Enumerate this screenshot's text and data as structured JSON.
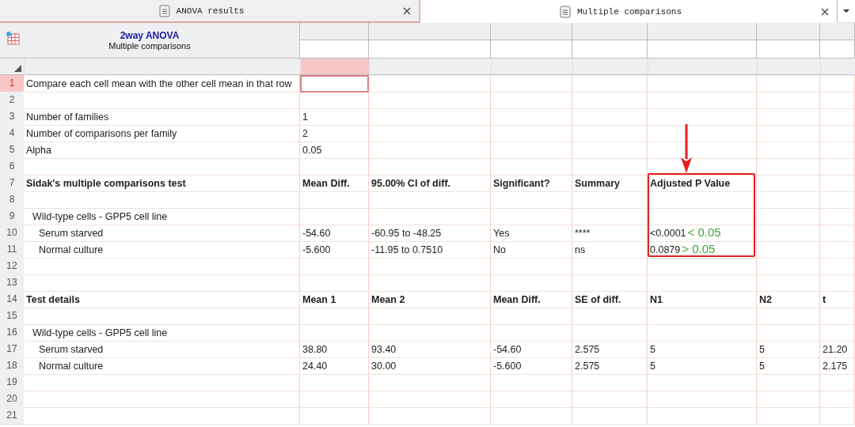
{
  "tabs": [
    {
      "label": "ANOVA results",
      "selected": false
    },
    {
      "label": "Multiple comparisons",
      "selected": true
    }
  ],
  "sheet_header": {
    "title": "2way ANOVA",
    "subtitle": "Multiple comparisons"
  },
  "column_headers": [
    {
      "selected": false
    },
    {
      "selected": true
    },
    {
      "selected": false
    },
    {
      "selected": false
    },
    {
      "selected": false
    },
    {
      "selected": false
    },
    {
      "selected": false
    },
    {
      "selected": false
    }
  ],
  "rows": [
    {
      "number": "1",
      "kind": "plain",
      "selected": true,
      "cells": {
        "A": "Compare each cell mean with the other cell mean in that row"
      }
    },
    {
      "number": "2",
      "kind": "plain",
      "selected": false,
      "cells": {}
    },
    {
      "number": "3",
      "kind": "plain",
      "selected": false,
      "cells": {
        "A": "Number of families",
        "B": "1"
      }
    },
    {
      "number": "4",
      "kind": "plain",
      "selected": false,
      "cells": {
        "A": "Number of comparisons per family",
        "B": "2"
      }
    },
    {
      "number": "5",
      "kind": "plain",
      "selected": false,
      "cells": {
        "A": "Alpha",
        "B": "0.05"
      }
    },
    {
      "number": "6",
      "kind": "plain",
      "selected": false,
      "cells": {}
    },
    {
      "number": "7",
      "kind": "heading",
      "selected": false,
      "boxed": true,
      "cells": {
        "A": "Sidak's multiple comparisons test",
        "B": "Mean Diff.",
        "C": "95.00% CI of diff.",
        "D": "Significant?",
        "E": "Summary",
        "F": "Adjusted P Value"
      }
    },
    {
      "number": "8",
      "kind": "plain",
      "selected": false,
      "boxed": true,
      "cells": {}
    },
    {
      "number": "9",
      "kind": "group",
      "selected": false,
      "boxed": true,
      "cells": {
        "A": "Wild-type cells - GPP5 cell line"
      }
    },
    {
      "number": "10",
      "kind": "item",
      "selected": false,
      "boxed": true,
      "cells": {
        "A": "Serum starved",
        "B": "-54.60",
        "C": "-60.95 to -48.25",
        "D": "Yes",
        "E": "****",
        "F": "<0.0001"
      },
      "note": "< 0.05"
    },
    {
      "number": "11",
      "kind": "item",
      "selected": false,
      "boxed": true,
      "cells": {
        "A": "Normal culture",
        "B": "-5.600",
        "C": "-11.95 to 0.7510",
        "D": "No",
        "E": "ns",
        "F": "0.0879"
      },
      "note": "> 0.05"
    },
    {
      "number": "12",
      "kind": "plain",
      "selected": false,
      "cells": {}
    },
    {
      "number": "13",
      "kind": "plain",
      "selected": false,
      "cells": {}
    },
    {
      "number": "14",
      "kind": "heading",
      "selected": false,
      "cells": {
        "A": "Test details",
        "B": "Mean 1",
        "C": "Mean 2",
        "D": "Mean Diff.",
        "E": "SE of diff.",
        "F": "N1",
        "G": "N2",
        "H": "t"
      }
    },
    {
      "number": "15",
      "kind": "plain",
      "selected": false,
      "cells": {}
    },
    {
      "number": "16",
      "kind": "group",
      "selected": false,
      "cells": {
        "A": "Wild-type cells - GPP5 cell line"
      }
    },
    {
      "number": "17",
      "kind": "item",
      "selected": false,
      "cells": {
        "A": "Serum starved",
        "B": "38.80",
        "C": "93.40",
        "D": "-54.60",
        "E": "2.575",
        "F": "5",
        "G": "5",
        "H": "21.20"
      }
    },
    {
      "number": "18",
      "kind": "item",
      "selected": false,
      "cells": {
        "A": "Normal culture",
        "B": "24.40",
        "C": "30.00",
        "D": "-5.600",
        "E": "2.575",
        "F": "5",
        "G": "5",
        "H": "2.175"
      }
    },
    {
      "number": "19",
      "kind": "plain",
      "selected": false,
      "cells": {}
    },
    {
      "number": "20",
      "kind": "plain",
      "selected": false,
      "cells": {}
    },
    {
      "number": "21",
      "kind": "plain",
      "selected": false,
      "cells": {}
    }
  ]
}
